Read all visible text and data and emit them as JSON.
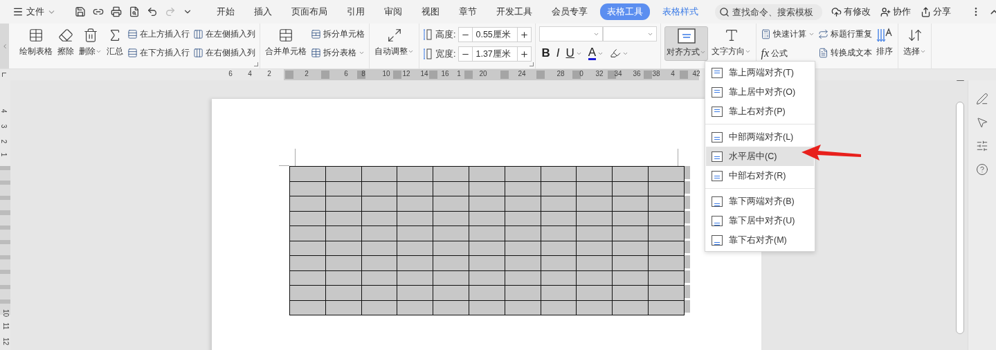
{
  "menu_bar": {
    "file_menu": "文件",
    "tabs": [
      {
        "label": "开始",
        "selected": false,
        "kind": "tab"
      },
      {
        "label": "插入",
        "selected": false,
        "kind": "tab"
      },
      {
        "label": "页面布局",
        "selected": false,
        "kind": "tab"
      },
      {
        "label": "引用",
        "selected": false,
        "kind": "tab"
      },
      {
        "label": "审阅",
        "selected": false,
        "kind": "tab"
      },
      {
        "label": "视图",
        "selected": false,
        "kind": "tab"
      },
      {
        "label": "章节",
        "selected": false,
        "kind": "tab"
      },
      {
        "label": "开发工具",
        "selected": false,
        "kind": "tab"
      },
      {
        "label": "会员专享",
        "selected": false,
        "kind": "tab"
      },
      {
        "label": "表格工具",
        "selected": true,
        "kind": "context"
      },
      {
        "label": "表格样式",
        "selected": false,
        "kind": "context"
      }
    ],
    "search": {
      "placeholder": "查找命令、搜索模板"
    },
    "actions": [
      "有修改",
      "协作",
      "分享"
    ]
  },
  "ribbon": {
    "groups": [
      {
        "launcher": true,
        "columns": [
          [
            {
              "kind": "large",
              "label": "绘制表格",
              "dropdown": false
            }
          ],
          [
            {
              "kind": "large",
              "label": "擦除",
              "dropdown": false
            }
          ],
          [
            {
              "kind": "large",
              "label": "删除",
              "dropdown": true
            }
          ],
          [
            {
              "kind": "large",
              "label": "汇总",
              "dropdown": false
            }
          ],
          [
            {
              "kind": "small",
              "label": "在上方插入行",
              "dropdown": false
            },
            {
              "kind": "small",
              "label": "在下方插入行",
              "dropdown": false
            }
          ],
          [
            {
              "kind": "small",
              "label": "在左侧插入列",
              "dropdown": false
            },
            {
              "kind": "small",
              "label": "在右侧插入列",
              "dropdown": false
            }
          ]
        ]
      },
      {
        "launcher": false,
        "columns": [
          [
            {
              "kind": "large",
              "label": "合并单元格",
              "dropdown": false
            }
          ],
          [
            {
              "kind": "small",
              "label": "拆分单元格",
              "dropdown": false
            },
            {
              "kind": "small",
              "label": "拆分表格",
              "dropdown": true
            }
          ]
        ]
      },
      {
        "launcher": false,
        "columns": [
          [
            {
              "kind": "large",
              "label": "自动调整",
              "dropdown": true
            }
          ]
        ]
      },
      {
        "launcher": true,
        "columns": [
          [
            {
              "kind": "spinner",
              "label": "高度:",
              "value": "0.55厘米"
            },
            {
              "kind": "spinner",
              "label": "宽度:",
              "value": "1.37厘米"
            }
          ]
        ]
      },
      {
        "launcher": false,
        "columns": [
          [
            {
              "kind": "selects"
            },
            {
              "kind": "formats",
              "items": [
                {
                  "glyph": "B",
                  "dropdown": false
                },
                {
                  "glyph": "I",
                  "dropdown": false
                },
                {
                  "glyph": "U",
                  "dropdown": true
                },
                {
                  "glyph": "A",
                  "dropdown": true
                },
                {
                  "dropdown": true
                }
              ]
            }
          ]
        ]
      },
      {
        "launcher": false,
        "columns": [
          [
            {
              "kind": "large",
              "label": "对齐方式",
              "dropdown": true,
              "pressed": true
            }
          ],
          [
            {
              "kind": "large",
              "label": "文字方向",
              "dropdown": true,
              "pressed": false
            }
          ]
        ]
      },
      {
        "launcher": false,
        "columns": [
          [
            {
              "kind": "small",
              "label": "快速计算",
              "dropdown": true
            },
            {
              "kind": "formula",
              "glyph": "fx",
              "label": "公式"
            }
          ],
          [
            {
              "kind": "small",
              "label": "标题行重复",
              "dropdown": false
            },
            {
              "kind": "small",
              "label": "转换成文本",
              "dropdown": false
            }
          ],
          [
            {
              "kind": "large",
              "label": "排序",
              "dropdown": false
            }
          ]
        ]
      },
      {
        "launcher": false,
        "columns": [
          [
            {
              "kind": "large",
              "label": "选择",
              "dropdown": true
            }
          ]
        ]
      }
    ]
  },
  "ruler": {
    "horizontal": [
      "6",
      "4",
      "2",
      "2",
      "6",
      "8",
      "10",
      "12",
      "14",
      "16",
      "1",
      "20",
      "24",
      "28",
      "0",
      "32",
      "34",
      "36",
      "38",
      "4",
      "42"
    ],
    "vertical": [
      "4",
      "3",
      "2",
      "1",
      "10",
      "11",
      "12"
    ]
  },
  "align_menu": {
    "sections": [
      [
        {
          "label": "靠上两端对齐(T)",
          "selected": false
        },
        {
          "label": "靠上居中对齐(O)",
          "selected": false
        },
        {
          "label": "靠上右对齐(P)",
          "selected": false
        }
      ],
      [
        {
          "label": "中部两端对齐(L)",
          "selected": false
        },
        {
          "label": "水平居中(C)",
          "selected": true
        },
        {
          "label": "中部右对齐(R)",
          "selected": false
        }
      ],
      [
        {
          "label": "靠下两端对齐(B)",
          "selected": false
        },
        {
          "label": "靠下居中对齐(U)",
          "selected": false
        },
        {
          "label": "靠下右对齐(M)",
          "selected": false
        }
      ]
    ]
  }
}
